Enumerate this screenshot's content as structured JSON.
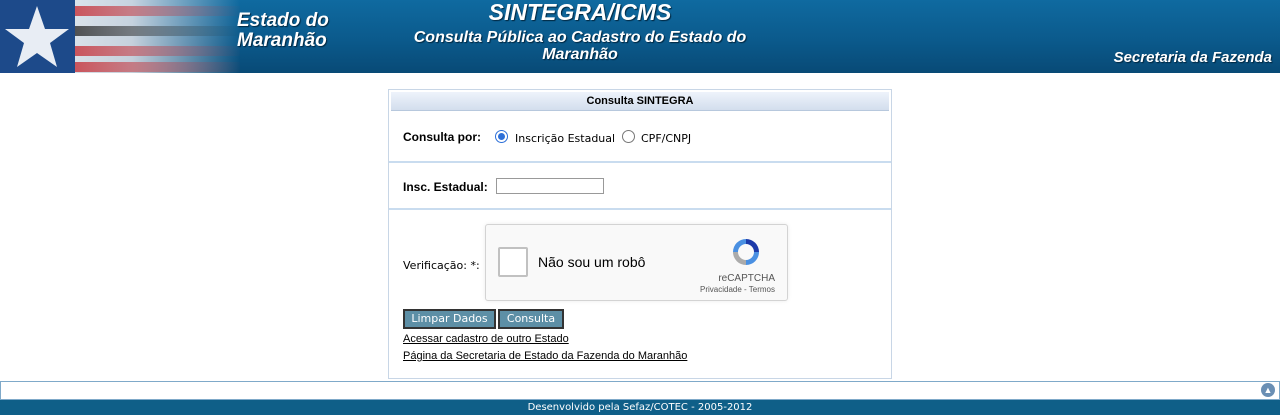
{
  "header": {
    "state_line1": "Estado do",
    "state_line2": "Maranhão",
    "title": "SINTEGRA/ICMS",
    "subtitle_line1": "Consulta Pública ao Cadastro do Estado do",
    "subtitle_line2": "Maranhão",
    "secretaria": "Secretaria da Fazenda"
  },
  "panel": {
    "title": "Consulta SINTEGRA",
    "consulta_por_label": "Consulta por:",
    "options": [
      {
        "label": "Inscrição Estadual",
        "selected": true
      },
      {
        "label": "CPF/CNPJ",
        "selected": false
      }
    ],
    "insc_label": "Insc. Estadual:",
    "insc_value": "",
    "verificacao_label": "Verificação: *:",
    "captcha": {
      "text": "Não sou um robô",
      "brand": "reCAPTCHA",
      "terms": "Privacidade - Termos",
      "icon": "recaptcha-logo-icon"
    },
    "buttons": {
      "clear": "Limpar Dados",
      "submit": "Consulta"
    },
    "links": [
      "Acessar cadastro de outro Estado",
      "Página da Secretaria de Estado da Fazenda do Maranhão"
    ]
  },
  "footer": {
    "credit": "Desenvolvido pela Sefaz/COTEC - 2005-2012",
    "scroll_icon": "arrow-up-icon"
  },
  "colors": {
    "banner": "#0b5a8c",
    "button": "#5d8fa6",
    "footer": "#0f5f88"
  }
}
